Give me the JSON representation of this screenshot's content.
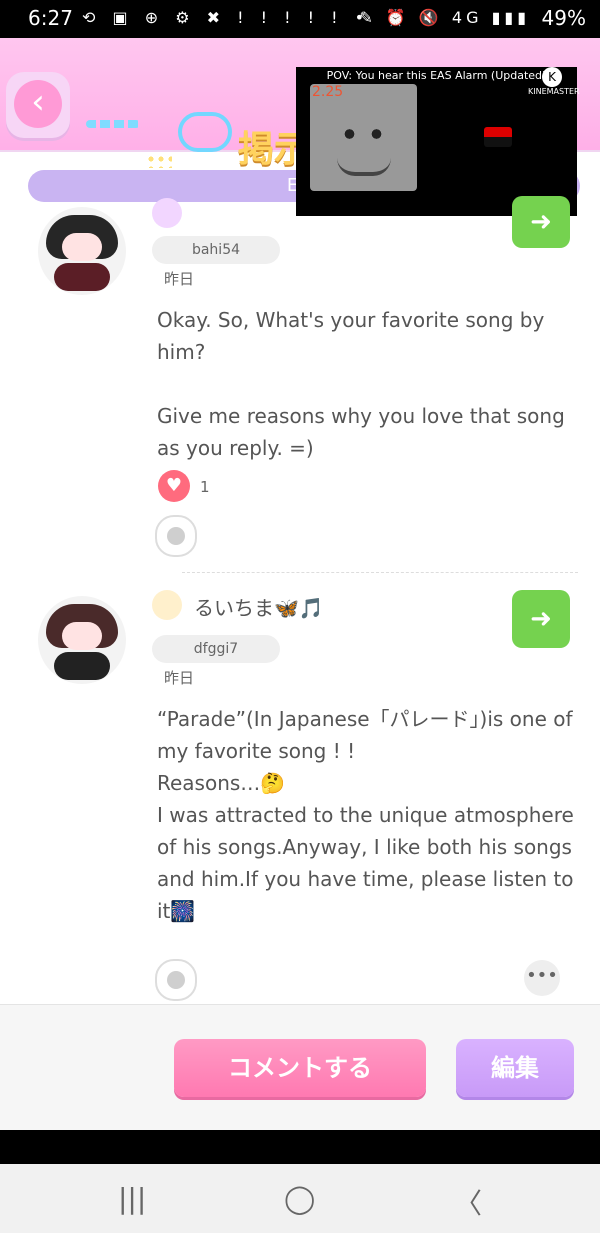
{
  "status_bar": {
    "time": "6:27",
    "battery": "49%",
    "left_icons": "⟲ ▣ ⊕ ⚙ ✖ ! ! ! ! ! •",
    "right_icons": "✎ ⏰ 🔇 4G ▮▮▮"
  },
  "header": {
    "title": "掲示"
  },
  "language_bar": {
    "label": "Eng"
  },
  "video_overlay": {
    "title": "POV: You hear this EAS Alarm (Updated)",
    "counter": "2.25",
    "watermark": "KINEMASTER",
    "watermark_letter": "K"
  },
  "comments": [
    {
      "user_id": "bahi54",
      "date": "昨日",
      "message_lines": [
        "Okay. So, What's your favorite song by him?",
        "",
        "Give me reasons why you love that song as you reply. =)"
      ],
      "reaction_count": "1"
    },
    {
      "username": "るいちま🦋🎵",
      "user_id": "dfggi7",
      "date": "昨日",
      "message_lines": [
        "“Parade”(In Japanese「パレード」)is one of my favorite song ! !",
        "Reasons…🤔",
        "I was attracted to the unique atmosphere of his songs.Anyway, I like both his songs and him.If you have time, please listen to it🎆"
      ],
      "more_label": "•••"
    }
  ],
  "bottom_actions": {
    "comment_label": "コメントする",
    "edit_label": "編集"
  },
  "nav_bar": {
    "recent": "|||",
    "home": "◯",
    "back": "〈"
  }
}
